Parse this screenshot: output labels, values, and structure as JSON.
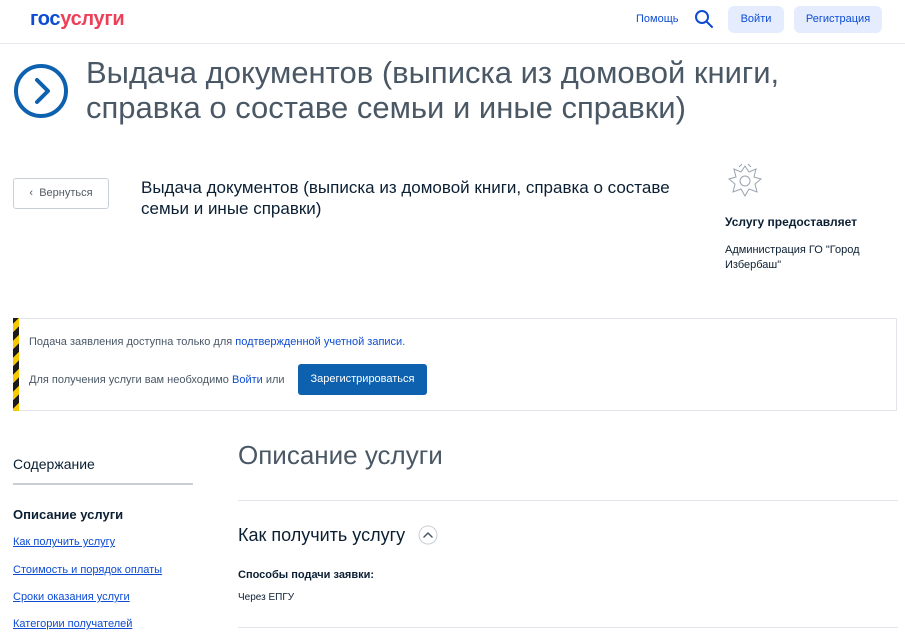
{
  "header": {
    "logo_part1": "гос",
    "logo_part2": "услуги",
    "help_label": "Помощь",
    "login_label": "Войти",
    "register_label": "Регистрация"
  },
  "hero": {
    "title": "Выдача документов (выписка из домовой книги, справка о составе семьи и иные справки)"
  },
  "service": {
    "back_label": "Вернуться",
    "title": "Выдача документов (выписка из домовой книги, справка о составе семьи и иные справки)",
    "provider_label": "Услугу предоставляет",
    "provider_value": "Администрация ГО \"Город Избербаш\""
  },
  "notice": {
    "line1_text": "Подача заявления доступна только для ",
    "line1_link": "подтвержденной учетной записи",
    "line1_end": ".",
    "line2_text": "Для получения услуги вам необходимо ",
    "line2_link": "Войти",
    "line2_end": " или",
    "register_button": "Зарегистрироваться"
  },
  "toc": {
    "title": "Содержание",
    "active": "Описание услуги",
    "links": [
      "Как получить услугу",
      "Стоимость и порядок оплаты",
      "Сроки оказания услуги",
      "Категории получателей"
    ]
  },
  "main": {
    "section_title": "Описание услуги",
    "how_title": "Как получить услугу",
    "methods_label": "Способы подачи заявки:",
    "methods_value": "Через ЕПГУ"
  },
  "colors": {
    "brand_blue": "#0d4cd3",
    "brand_red": "#ee3f58",
    "button_blue": "#0d61af",
    "stripe_yellow": "#f6c800"
  }
}
